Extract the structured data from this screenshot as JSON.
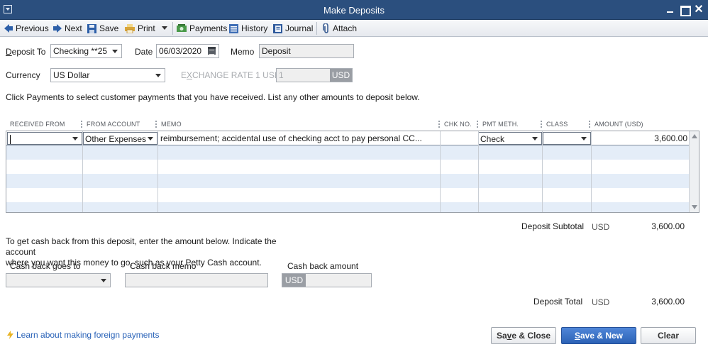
{
  "window": {
    "title": "Make Deposits"
  },
  "toolbar": {
    "previous": "Previous",
    "next": "Next",
    "save": "Save",
    "print": "Print",
    "payments": "Payments",
    "history": "History",
    "journal": "Journal",
    "attach": "Attach"
  },
  "header": {
    "deposit_to_label_u": "D",
    "deposit_to_label_rest": "eposit To",
    "deposit_to_value": "Checking **25",
    "date_label": "Date",
    "date_value": "06/03/2020",
    "memo_label": "Memo",
    "memo_value": "Deposit",
    "currency_label": "Currency",
    "currency_value": "US Dollar",
    "exchange_label_pre": "E",
    "exchange_label_u": "X",
    "exchange_label_post": "CHANGE RATE 1 USD =",
    "exchange_value": "1",
    "exchange_currency": "USD"
  },
  "instructions": "Click Payments to select customer payments that you have received. List any other amounts to deposit below.",
  "table": {
    "columns": [
      "RECEIVED FROM",
      "FROM ACCOUNT",
      "MEMO",
      "CHK NO.",
      "PMT METH.",
      "CLASS",
      "AMOUNT (USD)"
    ],
    "rows": [
      {
        "received_from": "",
        "from_account": "Other Expenses",
        "memo": "reimbursement; accidental use of checking acct to pay personal CC...",
        "chk_no": "",
        "pmt_meth": "Check",
        "class": "",
        "amount": "3,600.00"
      }
    ]
  },
  "subtotal": {
    "label": "Deposit Subtotal",
    "currency": "USD",
    "value": "3,600.00"
  },
  "cash_back": {
    "note_line1": "To get cash back from this deposit, enter the amount below.  Indicate the account",
    "note_line2": "where you want this money to go, such as your Petty Cash account.",
    "goes_to_label": "Cash back goes to",
    "memo_label": "Cash back memo",
    "amount_label": "Cash back amount",
    "amount_currency": "USD"
  },
  "total": {
    "label": "Deposit Total",
    "currency": "USD",
    "value": "3,600.00"
  },
  "footer": {
    "learn_link": "Learn about making foreign payments",
    "save_close_pre": "Sa",
    "save_close_u": "v",
    "save_close_post": "e & Close",
    "save_new_u": "S",
    "save_new_post": "ave & New",
    "clear": "Clear"
  },
  "colors": {
    "titlebar": "#2b4f7e",
    "row_alt": "#e4edf8",
    "primary_button": "#2c62b6",
    "link": "#2a63b8"
  }
}
